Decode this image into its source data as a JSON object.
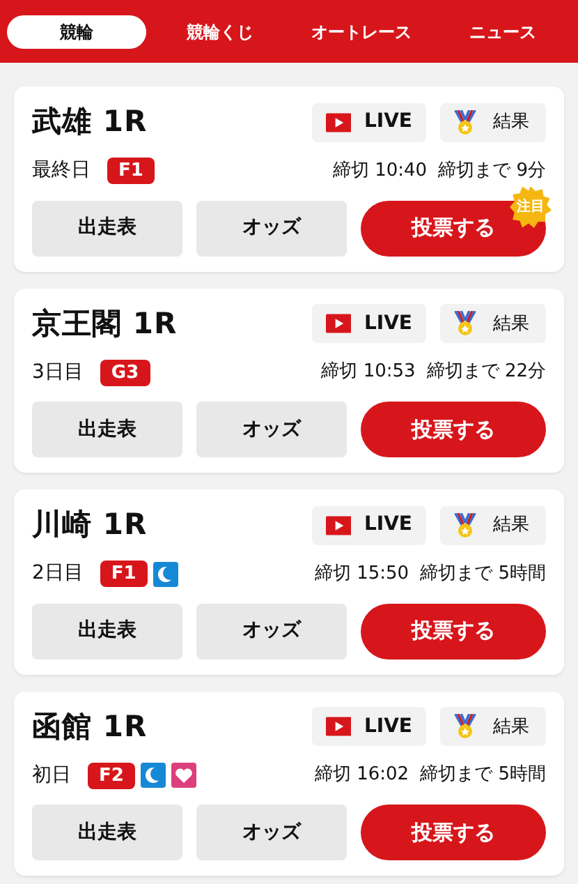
{
  "tabs": [
    {
      "label": "競輪",
      "selected": true
    },
    {
      "label": "競輪くじ",
      "selected": false
    },
    {
      "label": "オートレース",
      "selected": false
    },
    {
      "label": "ニュース",
      "selected": false
    }
  ],
  "races": [
    {
      "title": "武雄 1R",
      "day": "最終日",
      "badges": [
        {
          "kind": "grade",
          "text": "F1"
        }
      ],
      "live": "LIVE",
      "result": "結果",
      "deadline": "締切 10:40",
      "remaining": "締切まで 9分",
      "buttons": [
        "出走表",
        "オッズ"
      ],
      "bet": "投票する",
      "featured": "注目"
    },
    {
      "title": "京王閣 1R",
      "day": "3日目",
      "badges": [
        {
          "kind": "grade",
          "text": "G3"
        }
      ],
      "live": "LIVE",
      "result": "結果",
      "deadline": "締切 10:53",
      "remaining": "締切まで 22分",
      "buttons": [
        "出走表",
        "オッズ"
      ],
      "bet": "投票する"
    },
    {
      "title": "川崎 1R",
      "day": "2日目",
      "badges": [
        {
          "kind": "grade",
          "text": "F1"
        },
        {
          "kind": "night"
        }
      ],
      "live": "LIVE",
      "result": "結果",
      "deadline": "締切 15:50",
      "remaining": "締切まで 5時間",
      "buttons": [
        "出走表",
        "オッズ"
      ],
      "bet": "投票する"
    },
    {
      "title": "函館 1R",
      "day": "初日",
      "badges": [
        {
          "kind": "grade",
          "text": "F2"
        },
        {
          "kind": "night"
        },
        {
          "kind": "girls"
        }
      ],
      "live": "LIVE",
      "result": "結果",
      "deadline": "締切 16:02",
      "remaining": "締切まで 5時間",
      "buttons": [
        "出走表",
        "オッズ"
      ],
      "bet": "投票する"
    }
  ]
}
